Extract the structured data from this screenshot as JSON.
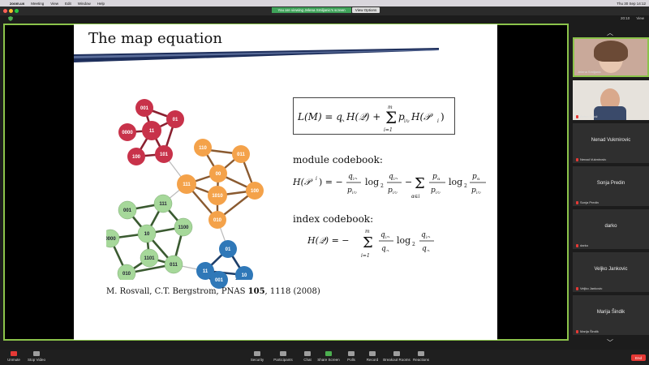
{
  "menubar": {
    "app": "zoom.us",
    "items": [
      "Meeting",
      "View",
      "Edit",
      "Window",
      "Help"
    ],
    "clock": "Thu 30 Sep 14:12"
  },
  "banner": {
    "sharing_text": "You are viewing Jelena Smiljanic's screen",
    "view_options": "View Options"
  },
  "topbar": {
    "time": "20:10",
    "view": "View"
  },
  "slide": {
    "title": "The map equation",
    "module_codebook": "module codebook:",
    "index_codebook": "index codebook:",
    "citation_pre": "M. Rosvall, C.T. Bergstrom, PNAS ",
    "citation_bold": "105",
    "citation_post": ", 1118 (2008)",
    "nodes": {
      "red": [
        "001",
        "01",
        "11",
        "0000",
        "100",
        "101"
      ],
      "orange": [
        "110",
        "011",
        "00",
        "1010",
        "111",
        "100",
        "010"
      ],
      "green": [
        "111",
        "001",
        "10",
        "1100",
        "0000",
        "1101",
        "011",
        "010"
      ],
      "blue": [
        "01",
        "11",
        "10",
        "001"
      ]
    }
  },
  "participants": [
    {
      "name": "",
      "label": "Jelena Smiljanic"
    },
    {
      "name": "",
      "label": "Antun Balaž"
    },
    {
      "name": "Nenad Vukmirovic",
      "label": "Nenad Vukmirovic"
    },
    {
      "name": "Sonja Predin",
      "label": "Sonja Predin"
    },
    {
      "name": "darko",
      "label": "darko"
    },
    {
      "name": "Veljko Jankovic",
      "label": "Veljko Jankovic"
    },
    {
      "name": "Marija Šindik",
      "label": "Marija Šindik"
    }
  ],
  "toolbar": {
    "unmute": "Unmute",
    "stop_video": "Stop Video",
    "security": "Security",
    "participants": "Participants",
    "participants_count": "16",
    "chat": "Chat",
    "share_screen": "Share Screen",
    "polls": "Polls",
    "record": "Record",
    "breakout": "Breakout Rooms",
    "reactions": "Reactions",
    "end": "End"
  },
  "colors": {
    "red_node": "#c8324a",
    "orange_node": "#f4a24a",
    "green_node": "#a6d89a",
    "blue_node": "#2f78b8",
    "frame": "#8bc34a",
    "end": "#e53935"
  }
}
